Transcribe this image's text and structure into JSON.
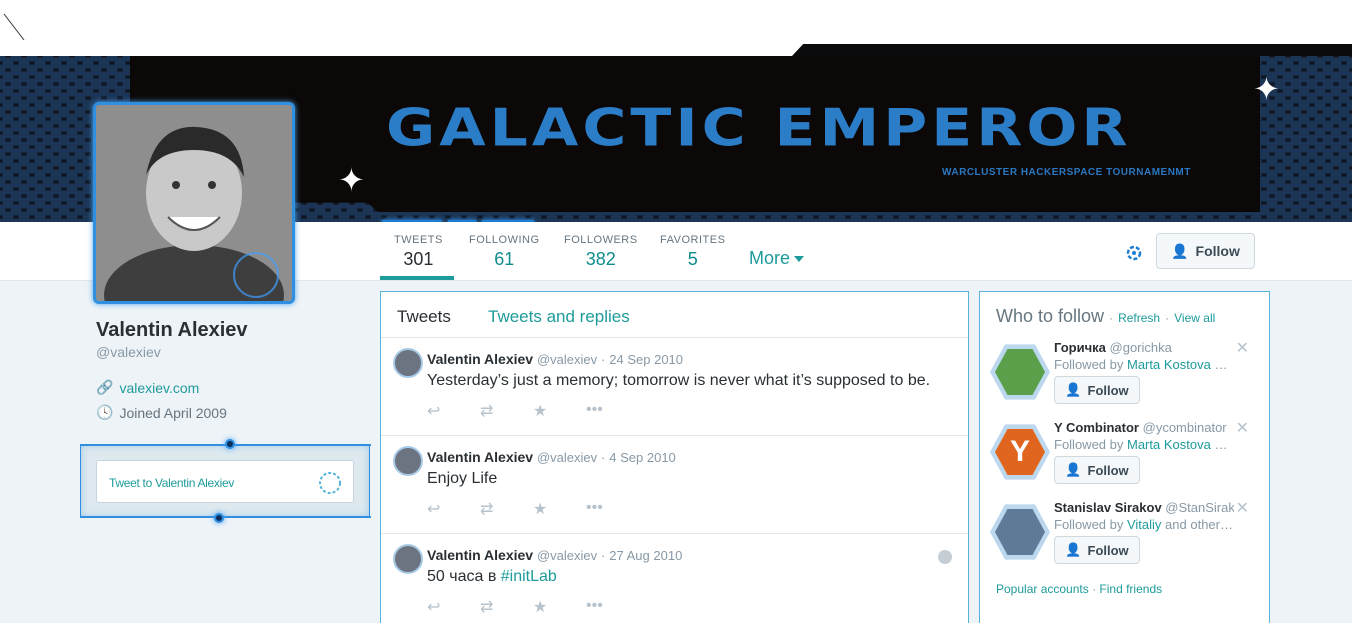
{
  "banner": {
    "title": "GALACTIC EMPEROR",
    "subtitle": "WARCLUSTER HACKERSPACE TOURNAMENMT"
  },
  "stats": [
    {
      "label": "TWEETS",
      "value": "301"
    },
    {
      "label": "FOLLOWING",
      "value": "61"
    },
    {
      "label": "FOLLOWERS",
      "value": "382"
    },
    {
      "label": "FAVORITES",
      "value": "5"
    }
  ],
  "nav": {
    "more_label": "More",
    "follow_label": "Follow"
  },
  "profile": {
    "name": "Valentin Alexiev",
    "handle": "@valexiev",
    "url": "valexiev.com",
    "joined": "Joined April 2009",
    "tweet_to": "Tweet to Valentin Alexiev"
  },
  "timeline": {
    "tab_active": "Tweets",
    "tab_other": "Tweets and replies",
    "tweets": [
      {
        "name": "Valentin Alexiev",
        "handle": "@valexiev",
        "date": "24 Sep 2010",
        "text": "Yesterday’s just a memory; tomorrow is never what it’s supposed to be.",
        "tag": ""
      },
      {
        "name": "Valentin Alexiev",
        "handle": "@valexiev",
        "date": "4 Sep 2010",
        "text": "Enjoy Life",
        "tag": ""
      },
      {
        "name": "Valentin Alexiev",
        "handle": "@valexiev",
        "date": "27 Aug 2010",
        "text": "50 часа в ",
        "tag": "#initLab"
      }
    ]
  },
  "who_to_follow": {
    "title": "Who to follow",
    "refresh": "Refresh",
    "view_all": "View all",
    "dot": "·",
    "suggestions": [
      {
        "name": "Горичка",
        "handle": "@gorichka",
        "followed_by_prefix": "Followed by ",
        "followed_by": "Marta Kostova",
        "followed_by_suffix": " a…",
        "follow_label": "Follow",
        "color": "#5aa04a"
      },
      {
        "name": "Y Combinator",
        "handle": "@ycombinator",
        "followed_by_prefix": "Followed by ",
        "followed_by": "Marta Kostova",
        "followed_by_suffix": " a…",
        "follow_label": "Follow",
        "color": "#e0661f"
      },
      {
        "name": "Stanislav Sirakov",
        "handle": "@StanSirak…",
        "followed_by_prefix": "Followed by ",
        "followed_by": "Vitaliy",
        "followed_by_suffix": " and other…",
        "follow_label": "Follow",
        "color": "#5d7a96"
      }
    ],
    "popular": "Popular accounts",
    "find_friends": "Find friends"
  }
}
